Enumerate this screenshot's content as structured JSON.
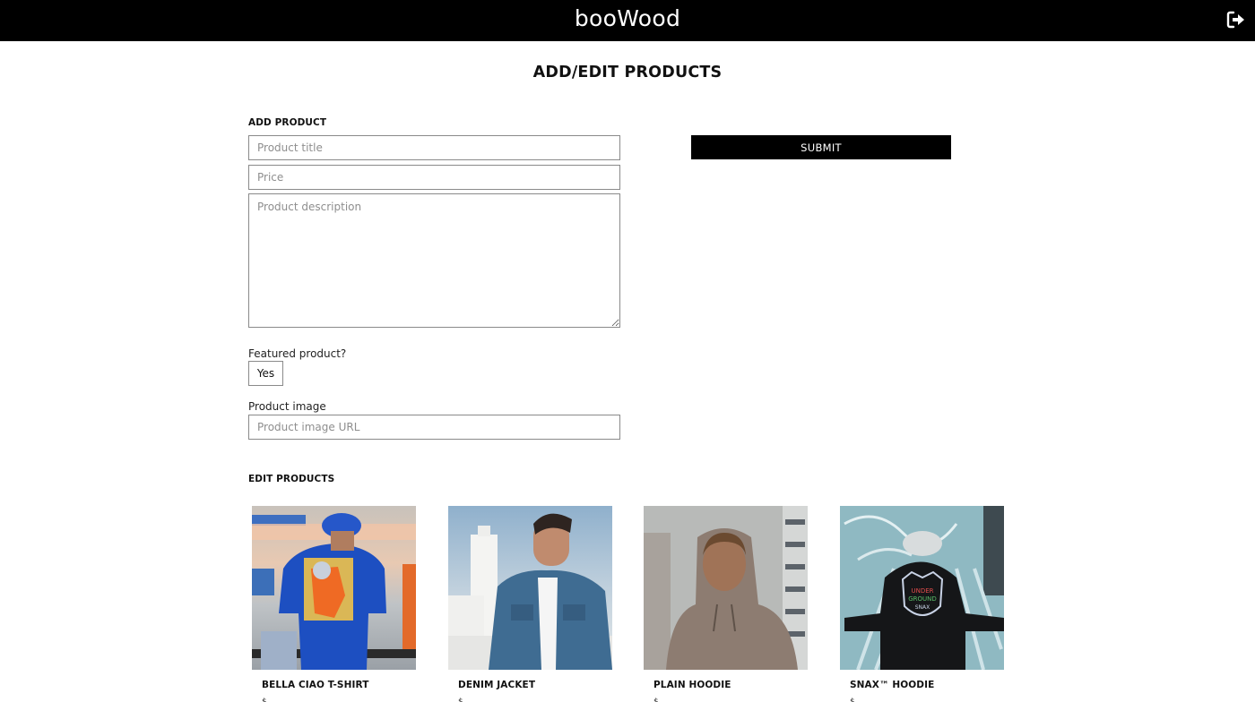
{
  "header": {
    "brand": "booWood",
    "logout_icon": "sign-out-icon"
  },
  "page": {
    "title": "ADD/EDIT PRODUCTS"
  },
  "add_product": {
    "section_label": "ADD PRODUCT",
    "title_placeholder": "Product title",
    "title_value": "",
    "price_placeholder": "Price",
    "price_value": "",
    "description_placeholder": "Product description",
    "description_value": "",
    "featured_label": "Featured product?",
    "featured_button": "Yes",
    "image_label": "Product image",
    "image_placeholder": "Product image URL",
    "image_value": "",
    "submit_label": "SUBMIT"
  },
  "edit_products": {
    "section_label": "EDIT PRODUCTS",
    "products": [
      {
        "name": "BELLA CIAO T-SHIRT",
        "price": "$",
        "image": "man-blue-tshirt-photo"
      },
      {
        "name": "DENIM JACKET",
        "price": "$",
        "image": "man-denim-jacket-photo"
      },
      {
        "name": "PLAIN HOODIE",
        "price": "$",
        "image": "man-brown-hoodie-photo"
      },
      {
        "name": "SNAX™ HOODIE",
        "price": "$",
        "image": "man-black-hoodie-photo"
      }
    ]
  },
  "colors": {
    "topbar": "#000000",
    "submit": "#000000",
    "border": "#8a8a8a",
    "placeholder": "#8e8e8e"
  }
}
